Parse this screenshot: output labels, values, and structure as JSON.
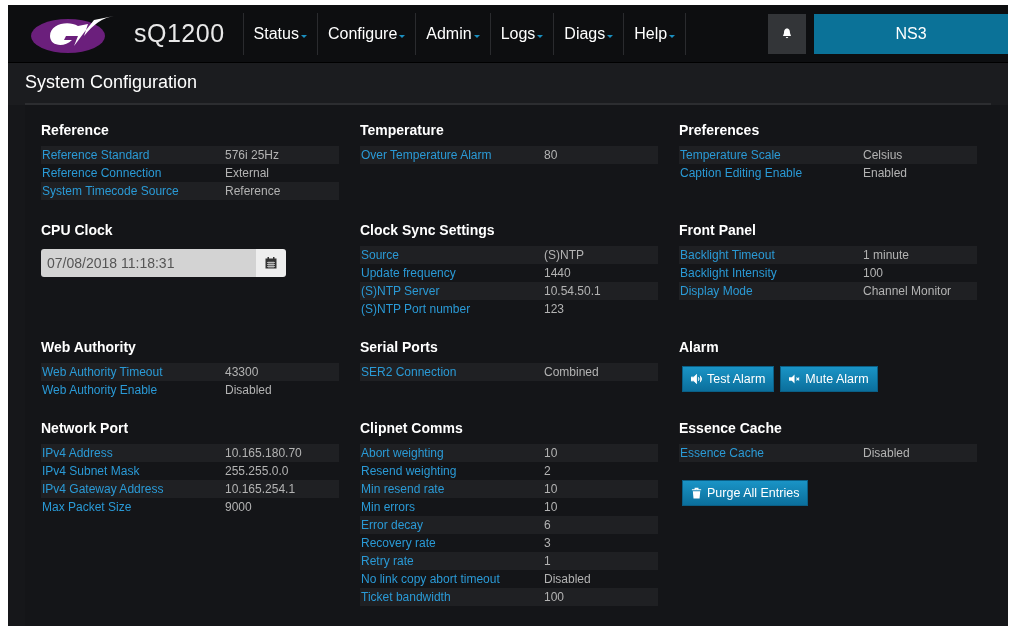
{
  "header": {
    "product": "sQ1200",
    "menu": [
      {
        "label": "Status"
      },
      {
        "label": "Configure"
      },
      {
        "label": "Admin"
      },
      {
        "label": "Logs"
      },
      {
        "label": "Diags"
      },
      {
        "label": "Help"
      }
    ],
    "server_button": "NS3"
  },
  "page_title": "System Configuration",
  "sections": [
    {
      "title": "Reference",
      "rows": [
        {
          "label": "Reference Standard",
          "value": "576i 25Hz"
        },
        {
          "label": "Reference Connection",
          "value": "External"
        },
        {
          "label": "System Timecode Source",
          "value": "Reference"
        }
      ]
    },
    {
      "title": "Temperature",
      "rows": [
        {
          "label": "Over Temperature Alarm",
          "value": "80"
        }
      ]
    },
    {
      "title": "Preferences",
      "rows": [
        {
          "label": "Temperature Scale",
          "value": "Celsius"
        },
        {
          "label": "Caption Editing Enable",
          "value": "Enabled"
        }
      ]
    },
    {
      "title": "CPU Clock",
      "datetime": "07/08/2018 11:18:31"
    },
    {
      "title": "Clock Sync Settings",
      "rows": [
        {
          "label": "Source",
          "value": "(S)NTP"
        },
        {
          "label": "Update frequency",
          "value": "1440"
        },
        {
          "label": "(S)NTP Server",
          "value": "10.54.50.1"
        },
        {
          "label": "(S)NTP Port number",
          "value": "123"
        }
      ]
    },
    {
      "title": "Front Panel",
      "rows": [
        {
          "label": "Backlight Timeout",
          "value": "1 minute"
        },
        {
          "label": "Backlight Intensity",
          "value": "100"
        },
        {
          "label": "Display Mode",
          "value": "Channel Monitor"
        }
      ]
    },
    {
      "title": "Web Authority",
      "rows": [
        {
          "label": "Web Authority Timeout",
          "value": "43300"
        },
        {
          "label": "Web Authority Enable",
          "value": "Disabled"
        }
      ]
    },
    {
      "title": "Serial Ports",
      "rows": [
        {
          "label": "SER2 Connection",
          "value": "Combined"
        }
      ]
    },
    {
      "title": "Alarm",
      "buttons": [
        {
          "label": "Test Alarm",
          "kind": "sound"
        },
        {
          "label": "Mute Alarm",
          "kind": "mute"
        }
      ]
    },
    {
      "title": "Network Port",
      "rows": [
        {
          "label": "IPv4 Address",
          "value": "10.165.180.70"
        },
        {
          "label": "IPv4 Subnet Mask",
          "value": "255.255.0.0"
        },
        {
          "label": "IPv4 Gateway Address",
          "value": "10.165.254.1"
        },
        {
          "label": "Max Packet Size",
          "value": "9000"
        }
      ]
    },
    {
      "title": "Clipnet Comms",
      "rows": [
        {
          "label": "Abort weighting",
          "value": "10"
        },
        {
          "label": "Resend weighting",
          "value": "2"
        },
        {
          "label": "Min resend rate",
          "value": "10"
        },
        {
          "label": "Min errors",
          "value": "10"
        },
        {
          "label": "Error decay",
          "value": "6"
        },
        {
          "label": "Recovery rate",
          "value": "3"
        },
        {
          "label": "Retry rate",
          "value": "1"
        },
        {
          "label": "No link copy abort timeout",
          "value": "Disabled"
        },
        {
          "label": "Ticket bandwidth",
          "value": "100"
        }
      ]
    },
    {
      "title": "Essence Cache",
      "rows": [
        {
          "label": "Essence Cache",
          "value": "Disabled"
        }
      ],
      "buttons": [
        {
          "label": "Purge All Entries",
          "kind": "trash"
        }
      ]
    }
  ]
}
